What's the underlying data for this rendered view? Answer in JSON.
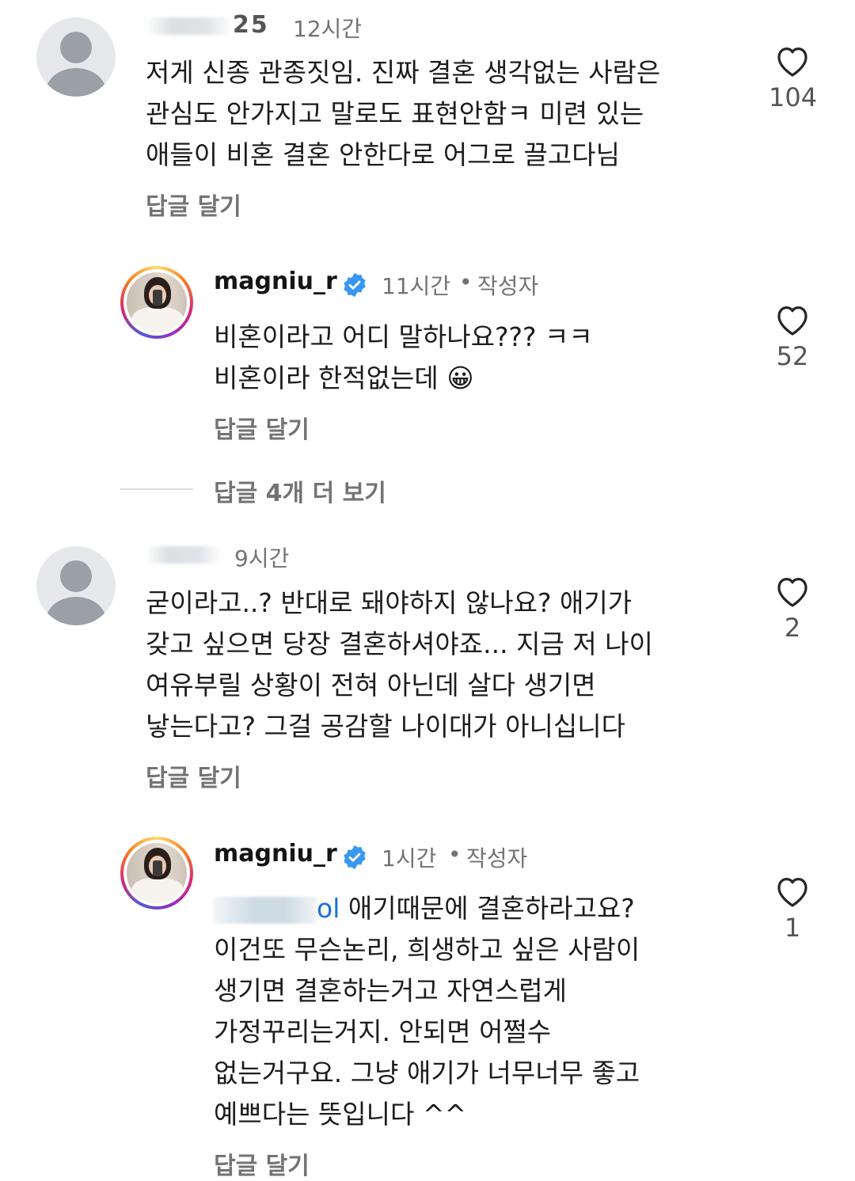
{
  "comments": [
    {
      "username_visible": "25",
      "time": "12시간",
      "text": "저게 신종 관종짓임. 진짜 결혼 생각없는 사람은\n관심도 안가지고 말로도 표현안함ㅋ 미련 있는\n애들이 비혼 결혼 안한다로 어그로 끌고다님",
      "reply_label": "답글 달기",
      "like_count": "104",
      "replies": [
        {
          "username": "magniu_r",
          "verified": true,
          "time": "11시간",
          "author_label": "작성자",
          "text": "비혼이라고 어디 말하나요??? ㅋㅋ\n비혼이라 한적없는데 😀",
          "reply_label": "답글 달기",
          "like_count": "52"
        }
      ],
      "more_replies_label": "답글 4개 더 보기"
    },
    {
      "username_visible": "",
      "time": "9시간",
      "text": "굳이라고..? 반대로 돼야하지 않나요?  애기가\n갖고 싶으면 당장 결혼하셔야죠... 지금 저 나이\n여유부릴 상황이 전혀 아닌데  살다 생기면\n낳는다고?  그걸 공감할 나이대가 아니십니다",
      "reply_label": "답글 달기",
      "like_count": "2",
      "replies": [
        {
          "username": "magniu_r",
          "verified": true,
          "time": "1시간",
          "author_label": "작성자",
          "mention_tail": "ol",
          "text": "애기때문에 결혼하라고요?\n이건또 무슨논리, 희생하고 싶은 사람이\n생기면 결혼하는거고 자연스럽게\n가정꾸리는거지. 안되면 어쩔수\n없는거구요. 그냥 애기가 너무너무 좋고\n예쁘다는 뜻입니다 ^^",
          "reply_label": "답글 달기",
          "like_count": "1"
        }
      ]
    }
  ],
  "colors": {
    "verified_badge": "#3897f0",
    "secondary_text": "#737373",
    "mention": "#1d6fe0"
  },
  "icons": {
    "like": "heart-outline-icon",
    "verified": "verified-badge-icon",
    "default_avatar": "default-avatar-icon"
  }
}
